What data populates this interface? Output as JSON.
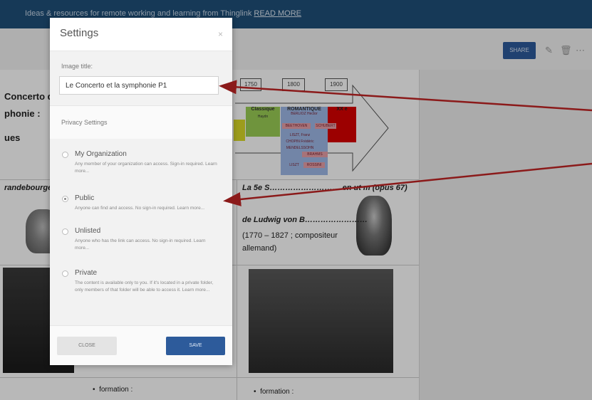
{
  "banner": {
    "text": "Ideas & resources for remote working and learning from Thinglink",
    "link": "READ MORE"
  },
  "toolbar": {
    "share_label": "SHARE",
    "edit_icon": "pencil-icon",
    "delete_icon": "trash-icon",
    "more_icon": "more-icon"
  },
  "document": {
    "title_line1": "Concerto d",
    "title_line2": "phonie :",
    "title_line3": "ues",
    "years": [
      "1750",
      "1800",
      "1900"
    ],
    "eras": {
      "classique": "Classique",
      "romantique": "ROMANTIQUE",
      "xx": "XX e",
      "haydn": "Haydn",
      "berlioz": "BERLIOZ Hector"
    },
    "composer_tags": [
      "BEETHOVEN",
      "SCHUBERT",
      "LISZT, Franz",
      "CHOPIN Frédéric",
      "MENDELSSOHN",
      "BRAHMS",
      "LISZT",
      "ROSSINI"
    ],
    "left_heading": "randebourgeo",
    "right_heading": "La 5e S……………………… en ut m (opus 67)",
    "beethoven_line1": "de Ludwig von B……………………",
    "beethoven_line2": "(1770 – 1827 ; compositeur",
    "beethoven_line3": "allemand)",
    "bullet_left": "formation :",
    "bullet_right": "formation :"
  },
  "modal": {
    "title": "Settings",
    "close_icon": "×",
    "image_title_label": "Image title:",
    "image_title_value": "Le Concerto et la symphonie P1",
    "privacy_label": "Privacy Settings",
    "options": [
      {
        "name": "My Organization",
        "desc": "Any member of your organization can access. Sign-in required. Learn more...",
        "checked": false
      },
      {
        "name": "Public",
        "desc": "Anyone can find and access. No sign-in required. Learn more...",
        "checked": true
      },
      {
        "name": "Unlisted",
        "desc": "Anyone who has the link can access. No sign-in required. Learn more...",
        "checked": false
      },
      {
        "name": "Private",
        "desc": "The content is available only to you. If it's located in a private folder, only members of that folder will be able to access it. Learn more...",
        "checked": false
      }
    ],
    "close_label": "CLOSE",
    "save_label": "SAVE"
  },
  "colors": {
    "banner_bg": "#1f4f79",
    "primary_button": "#2d5b9b",
    "annotation_arrow": "#8b1a1a"
  }
}
